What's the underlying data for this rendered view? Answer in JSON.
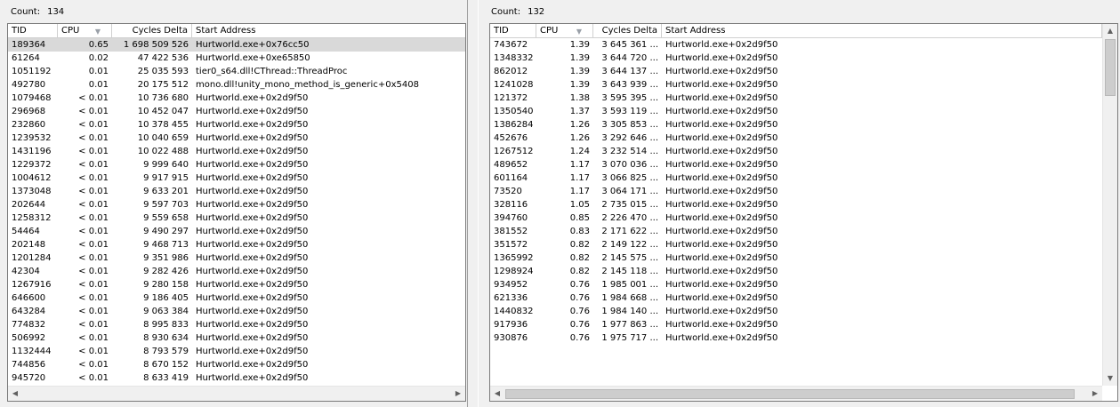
{
  "left": {
    "count_label": "Count:",
    "count_value": "134",
    "columns": {
      "tid": "TID",
      "cpu": "CPU",
      "cycles": "Cycles Delta",
      "start": "Start Address"
    },
    "rows": [
      [
        "189364",
        "0.65",
        "1 698 509 526",
        "Hurtworld.exe+0x76cc50"
      ],
      [
        "61264",
        "0.02",
        "47 422 536",
        "Hurtworld.exe+0xe65850"
      ],
      [
        "1051192",
        "0.01",
        "25 035 593",
        "tier0_s64.dll!CThread::ThreadProc"
      ],
      [
        "492780",
        "0.01",
        "20 175 512",
        "mono.dll!unity_mono_method_is_generic+0x5408"
      ],
      [
        "1079468",
        "< 0.01",
        "10 736 680",
        "Hurtworld.exe+0x2d9f50"
      ],
      [
        "296968",
        "< 0.01",
        "10 452 047",
        "Hurtworld.exe+0x2d9f50"
      ],
      [
        "232860",
        "< 0.01",
        "10 378 455",
        "Hurtworld.exe+0x2d9f50"
      ],
      [
        "1239532",
        "< 0.01",
        "10 040 659",
        "Hurtworld.exe+0x2d9f50"
      ],
      [
        "1431196",
        "< 0.01",
        "10 022 488",
        "Hurtworld.exe+0x2d9f50"
      ],
      [
        "1229372",
        "< 0.01",
        "9 999 640",
        "Hurtworld.exe+0x2d9f50"
      ],
      [
        "1004612",
        "< 0.01",
        "9 917 915",
        "Hurtworld.exe+0x2d9f50"
      ],
      [
        "1373048",
        "< 0.01",
        "9 633 201",
        "Hurtworld.exe+0x2d9f50"
      ],
      [
        "202644",
        "< 0.01",
        "9 597 703",
        "Hurtworld.exe+0x2d9f50"
      ],
      [
        "1258312",
        "< 0.01",
        "9 559 658",
        "Hurtworld.exe+0x2d9f50"
      ],
      [
        "54464",
        "< 0.01",
        "9 490 297",
        "Hurtworld.exe+0x2d9f50"
      ],
      [
        "202148",
        "< 0.01",
        "9 468 713",
        "Hurtworld.exe+0x2d9f50"
      ],
      [
        "1201284",
        "< 0.01",
        "9 351 986",
        "Hurtworld.exe+0x2d9f50"
      ],
      [
        "42304",
        "< 0.01",
        "9 282 426",
        "Hurtworld.exe+0x2d9f50"
      ],
      [
        "1267916",
        "< 0.01",
        "9 280 158",
        "Hurtworld.exe+0x2d9f50"
      ],
      [
        "646600",
        "< 0.01",
        "9 186 405",
        "Hurtworld.exe+0x2d9f50"
      ],
      [
        "643284",
        "< 0.01",
        "9 063 384",
        "Hurtworld.exe+0x2d9f50"
      ],
      [
        "774832",
        "< 0.01",
        "8 995 833",
        "Hurtworld.exe+0x2d9f50"
      ],
      [
        "506992",
        "< 0.01",
        "8 930 634",
        "Hurtworld.exe+0x2d9f50"
      ],
      [
        "1132444",
        "< 0.01",
        "8 793 579",
        "Hurtworld.exe+0x2d9f50"
      ],
      [
        "744856",
        "< 0.01",
        "8 670 152",
        "Hurtworld.exe+0x2d9f50"
      ],
      [
        "945720",
        "< 0.01",
        "8 633 419",
        "Hurtworld.exe+0x2d9f50"
      ]
    ]
  },
  "right": {
    "count_label": "Count:",
    "count_value": "132",
    "columns": {
      "tid": "TID",
      "cpu": "CPU",
      "cycles": "Cycles Delta",
      "start": "Start Address"
    },
    "rows": [
      [
        "743672",
        "1.39",
        "3 645 361 ...",
        "Hurtworld.exe+0x2d9f50"
      ],
      [
        "1348332",
        "1.39",
        "3 644 720 ...",
        "Hurtworld.exe+0x2d9f50"
      ],
      [
        "862012",
        "1.39",
        "3 644 137 ...",
        "Hurtworld.exe+0x2d9f50"
      ],
      [
        "1241028",
        "1.39",
        "3 643 939 ...",
        "Hurtworld.exe+0x2d9f50"
      ],
      [
        "121372",
        "1.38",
        "3 595 395 ...",
        "Hurtworld.exe+0x2d9f50"
      ],
      [
        "1350540",
        "1.37",
        "3 593 119 ...",
        "Hurtworld.exe+0x2d9f50"
      ],
      [
        "1386284",
        "1.26",
        "3 305 853 ...",
        "Hurtworld.exe+0x2d9f50"
      ],
      [
        "452676",
        "1.26",
        "3 292 646 ...",
        "Hurtworld.exe+0x2d9f50"
      ],
      [
        "1267512",
        "1.24",
        "3 232 514 ...",
        "Hurtworld.exe+0x2d9f50"
      ],
      [
        "489652",
        "1.17",
        "3 070 036 ...",
        "Hurtworld.exe+0x2d9f50"
      ],
      [
        "601164",
        "1.17",
        "3 066 825 ...",
        "Hurtworld.exe+0x2d9f50"
      ],
      [
        "73520",
        "1.17",
        "3 064 171 ...",
        "Hurtworld.exe+0x2d9f50"
      ],
      [
        "328116",
        "1.05",
        "2 735 015 ...",
        "Hurtworld.exe+0x2d9f50"
      ],
      [
        "394760",
        "0.85",
        "2 226 470 ...",
        "Hurtworld.exe+0x2d9f50"
      ],
      [
        "381552",
        "0.83",
        "2 171 622 ...",
        "Hurtworld.exe+0x2d9f50"
      ],
      [
        "351572",
        "0.82",
        "2 149 122 ...",
        "Hurtworld.exe+0x2d9f50"
      ],
      [
        "1365992",
        "0.82",
        "2 145 575 ...",
        "Hurtworld.exe+0x2d9f50"
      ],
      [
        "1298924",
        "0.82",
        "2 145 118 ...",
        "Hurtworld.exe+0x2d9f50"
      ],
      [
        "934952",
        "0.76",
        "1 985 001 ...",
        "Hurtworld.exe+0x2d9f50"
      ],
      [
        "621336",
        "0.76",
        "1 984 668 ...",
        "Hurtworld.exe+0x2d9f50"
      ],
      [
        "1440832",
        "0.76",
        "1 984 140 ...",
        "Hurtworld.exe+0x2d9f50"
      ],
      [
        "917936",
        "0.76",
        "1 977 863 ...",
        "Hurtworld.exe+0x2d9f50"
      ],
      [
        "930876",
        "0.76",
        "1 975 717 ...",
        "Hurtworld.exe+0x2d9f50"
      ]
    ]
  },
  "icons": {
    "sort": "sort-descending-icon",
    "scroll_up": "scroll-up-arrow-icon",
    "scroll_down": "scroll-down-arrow-icon",
    "scroll_left": "scroll-left-arrow-icon",
    "scroll_right": "scroll-right-arrow-icon"
  },
  "colors": {
    "selected_row": "#d9d9d9",
    "window_bg": "#f0f0f0"
  }
}
